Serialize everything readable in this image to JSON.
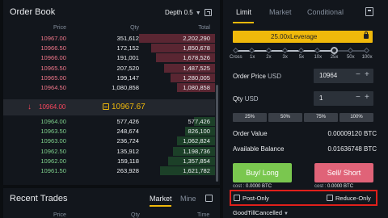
{
  "order_book": {
    "title": "Order Book",
    "depth_label": "Depth 0.5",
    "columns": {
      "price": "Price",
      "qty": "Qty",
      "total": "Total"
    },
    "asks": [
      {
        "price": "10967.00",
        "qty": "351,612",
        "total": "2,202,290",
        "depth": 0.36
      },
      {
        "price": "10966.50",
        "qty": "172,152",
        "total": "1,850,678",
        "depth": 0.3
      },
      {
        "price": "10966.00",
        "qty": "191,001",
        "total": "1,678,526",
        "depth": 0.28
      },
      {
        "price": "10965.50",
        "qty": "207,520",
        "total": "1,487,525",
        "depth": 0.24
      },
      {
        "price": "10965.00",
        "qty": "199,147",
        "total": "1,280,005",
        "depth": 0.21
      },
      {
        "price": "10964.50",
        "qty": "1,080,858",
        "total": "1,080,858",
        "depth": 0.18
      }
    ],
    "last_price": "10964.00",
    "mark_price": "10967.67",
    "bids": [
      {
        "price": "10964.00",
        "qty": "577,426",
        "total": "577,426",
        "depth": 0.1
      },
      {
        "price": "10963.50",
        "qty": "248,674",
        "total": "826,100",
        "depth": 0.14
      },
      {
        "price": "10963.00",
        "qty": "236,724",
        "total": "1,062,824",
        "depth": 0.18
      },
      {
        "price": "10962.50",
        "qty": "135,912",
        "total": "1,198,736",
        "depth": 0.2
      },
      {
        "price": "10962.00",
        "qty": "159,118",
        "total": "1,357,854",
        "depth": 0.22
      },
      {
        "price": "10961.50",
        "qty": "263,928",
        "total": "1,621,782",
        "depth": 0.26
      }
    ]
  },
  "recent_trades": {
    "title": "Recent Trades",
    "tabs": [
      "Market",
      "Mine"
    ],
    "columns": {
      "price": "Price",
      "qty": "Qty",
      "time": "Time"
    }
  },
  "trade_panel": {
    "tabs": [
      "Limit",
      "Market",
      "Conditional"
    ],
    "leverage_label": "25.00xLeverage",
    "leverage_marks": [
      "Cross",
      "1x",
      "2x",
      "3x",
      "5x",
      "10x",
      "25x",
      "50x",
      "100x"
    ],
    "leverage_value": 0.75,
    "order_price": {
      "label": "Order Price",
      "unit": "USD",
      "value": "10964",
      "minus": "−",
      "plus": "+"
    },
    "qty": {
      "label": "Qty",
      "unit": "USD",
      "value": "1",
      "minus": "−",
      "plus": "+"
    },
    "percent_buttons": [
      "25%",
      "50%",
      "75%",
      "100%"
    ],
    "order_value": {
      "label": "Order Value",
      "value": "0.00009120 BTC"
    },
    "available_balance": {
      "label": "Available Balance",
      "value": "0.01636748 BTC"
    },
    "buy_button": "Buy/ Long",
    "sell_button": "Sell/ Short",
    "buy_cost": {
      "label": "cost :",
      "value": "0.0000 BTC"
    },
    "sell_cost": {
      "label": "cost :",
      "value": "0.0000 BTC"
    },
    "post_only": "Post-Only",
    "reduce_only": "Reduce-Only",
    "time_in_force": "GoodTillCancelled"
  },
  "colors": {
    "ask": "#f0778a",
    "bid": "#7ed08c",
    "accent": "#f0b90b",
    "buy": "#7ac74f",
    "sell": "#e06378",
    "highlight": "#e0201b"
  }
}
